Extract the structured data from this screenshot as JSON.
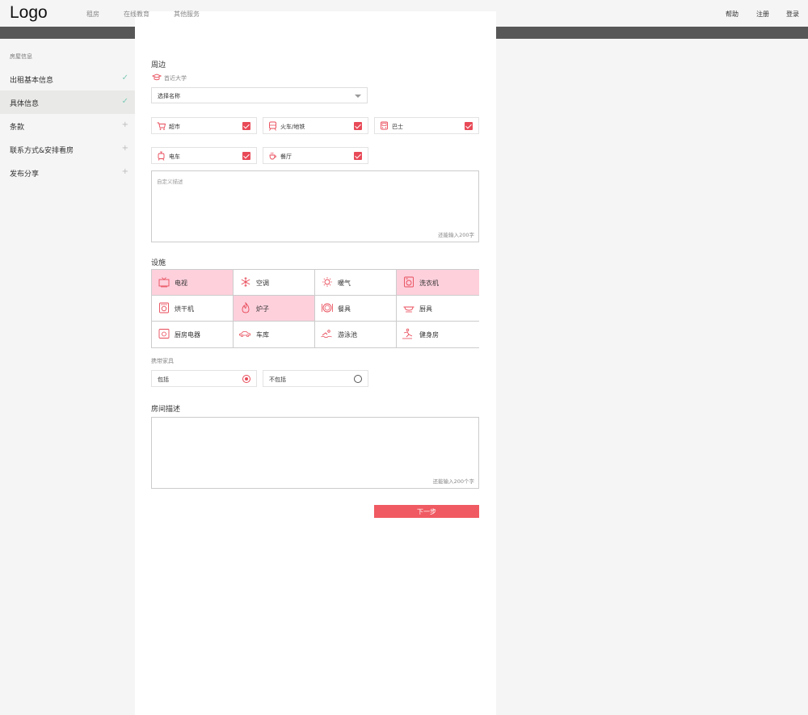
{
  "header": {
    "logo": "Logo",
    "nav": [
      "租房",
      "在线教育",
      "其他服务"
    ],
    "right": [
      "帮助",
      "注册",
      "登录"
    ]
  },
  "sidebar": {
    "heading": "房屋信息",
    "items": [
      {
        "label": "出租基本信息",
        "status": "done"
      },
      {
        "label": "具体信息",
        "status": "done"
      },
      {
        "label": "条款",
        "status": "todo"
      },
      {
        "label": "联系方式&安排看房",
        "status": "todo"
      },
      {
        "label": "发布分享",
        "status": "todo"
      }
    ]
  },
  "surroundings": {
    "title": "周边",
    "university_label": "首近大学",
    "select_value": "选择名称",
    "options": [
      {
        "label": "超市",
        "icon": "cart-icon",
        "checked": true
      },
      {
        "label": "火车/地铁",
        "icon": "train-icon",
        "checked": true
      },
      {
        "label": "巴士",
        "icon": "bus-icon",
        "checked": true
      },
      {
        "label": "电车",
        "icon": "tram-icon",
        "checked": true
      },
      {
        "label": "餐厅",
        "icon": "restaurant-icon",
        "checked": true
      }
    ],
    "custom_placeholder": "自定义描述",
    "custom_counter": "还能输入200字"
  },
  "facilities": {
    "title": "设施",
    "items": [
      {
        "label": "电视",
        "icon": "tv-icon",
        "selected": true
      },
      {
        "label": "空调",
        "icon": "snowflake-icon",
        "selected": false
      },
      {
        "label": "暖气",
        "icon": "sun-icon",
        "selected": false
      },
      {
        "label": "洗衣机",
        "icon": "washer-icon",
        "selected": true
      },
      {
        "label": "烘干机",
        "icon": "dryer-icon",
        "selected": false
      },
      {
        "label": "炉子",
        "icon": "flame-icon",
        "selected": true
      },
      {
        "label": "餐具",
        "icon": "tableware-icon",
        "selected": false
      },
      {
        "label": "厨具",
        "icon": "cookware-icon",
        "selected": false
      },
      {
        "label": "厨房电器",
        "icon": "oven-icon",
        "selected": false
      },
      {
        "label": "车库",
        "icon": "car-icon",
        "selected": false
      },
      {
        "label": "游泳池",
        "icon": "swimming-icon",
        "selected": false
      },
      {
        "label": "健身房",
        "icon": "fitness-icon",
        "selected": false
      }
    ],
    "accent": "#fdd0dc"
  },
  "furniture": {
    "label": "携带家具",
    "options": [
      {
        "label": "包括",
        "selected": true
      },
      {
        "label": "不包括",
        "selected": false
      }
    ]
  },
  "room_description": {
    "title": "房间描述",
    "counter": "还能输入200个字"
  },
  "next_button": "下一步",
  "colors": {
    "brand": "#e84a58",
    "button": "#f05a62",
    "header_bar": "#575757"
  }
}
